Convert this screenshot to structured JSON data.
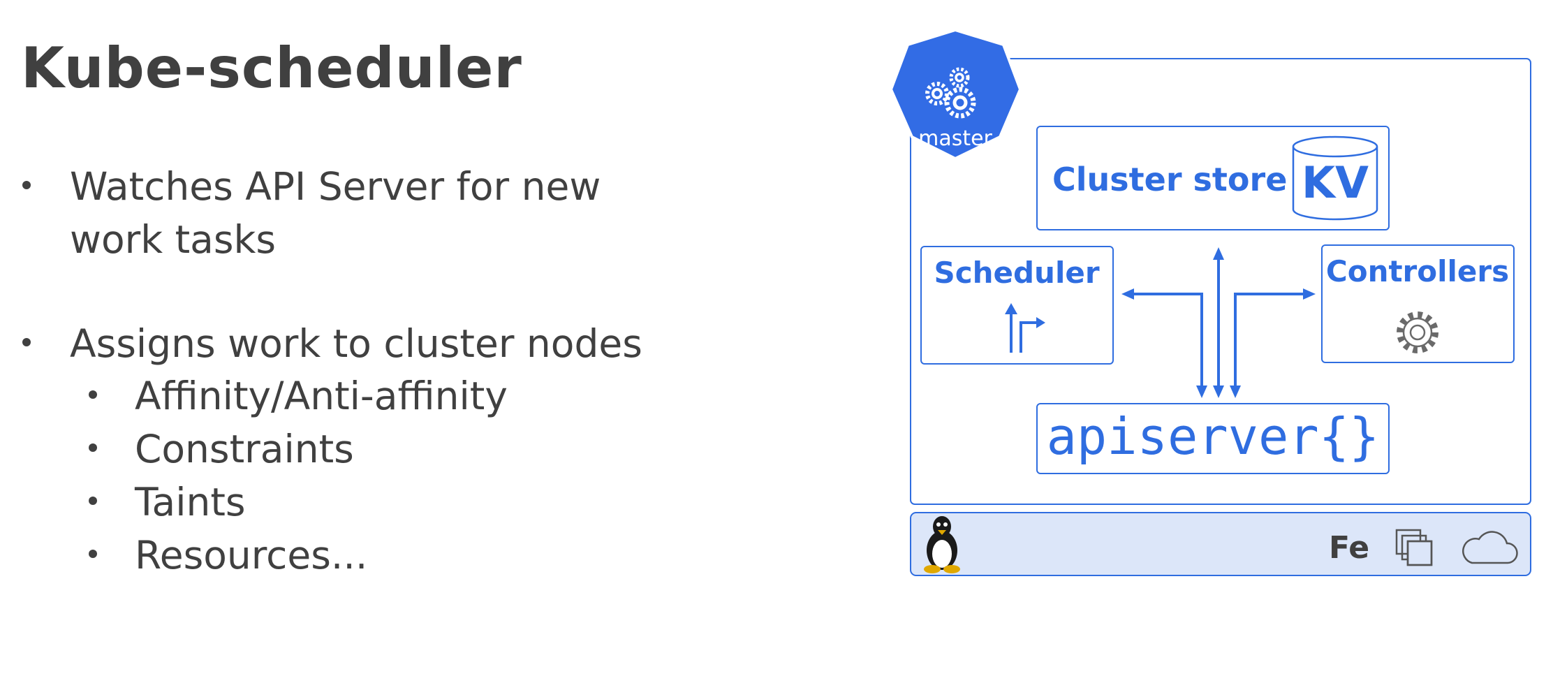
{
  "slide": {
    "title": "Kube-scheduler",
    "bullets": [
      {
        "lines": [
          "Watches API Server for new",
          "work tasks"
        ]
      },
      {
        "lines": [
          "Assigns work to cluster nodes"
        ],
        "sub": [
          "Affinity/Anti-affinity",
          "Constraints",
          "Taints",
          "Resources..."
        ]
      }
    ]
  },
  "diagram": {
    "badge_label": "master",
    "cluster_store_label": "Cluster store",
    "kv_label": "KV",
    "scheduler_label": "Scheduler",
    "controllers_label": "Controllers",
    "apiserver_label": "apiserver{}",
    "fe_label": "Fe",
    "colors": {
      "accent": "#2f6de0",
      "badge": "#326ce5",
      "footer_fill": "#dce6f9",
      "text": "#404040"
    },
    "icons": [
      "master-gears-icon",
      "database-cylinder-icon",
      "scheduler-arrows-icon",
      "gear-icon",
      "linux-penguin-icon",
      "vm-stack-icon",
      "cloud-icon"
    ]
  }
}
